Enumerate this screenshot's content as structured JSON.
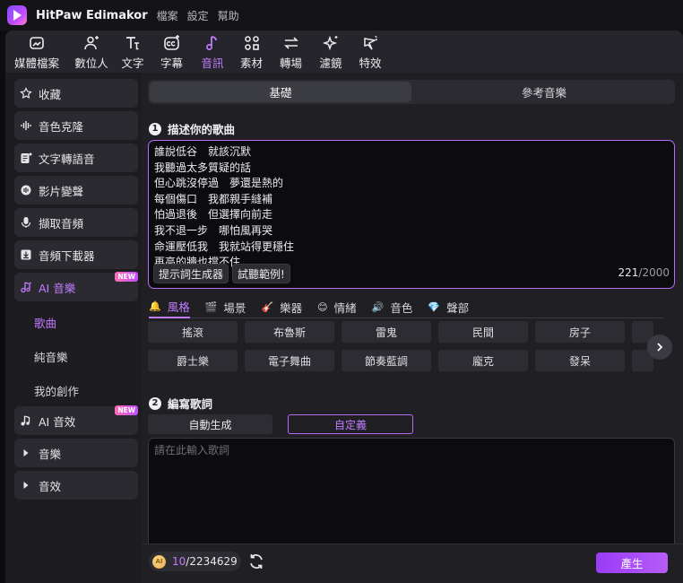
{
  "app": {
    "title": "HitPaw Edimakor",
    "menu": [
      "檔案",
      "設定",
      "幫助"
    ]
  },
  "toolbar": {
    "items": [
      {
        "label": "媒體檔案",
        "icon": "media-icon"
      },
      {
        "label": "數位人",
        "icon": "avatar-icon"
      },
      {
        "label": "文字",
        "icon": "text-icon"
      },
      {
        "label": "字幕",
        "icon": "subtitle-icon"
      },
      {
        "label": "音訊",
        "icon": "music-note-icon",
        "active": true
      },
      {
        "label": "素材",
        "icon": "material-icon"
      },
      {
        "label": "轉場",
        "icon": "transition-icon"
      },
      {
        "label": "濾鏡",
        "icon": "filter-icon"
      },
      {
        "label": "特效",
        "icon": "effect-icon"
      }
    ]
  },
  "sidebar": {
    "items": [
      {
        "label": "收藏",
        "icon": "star-icon"
      },
      {
        "label": "音色克隆",
        "icon": "waveform-icon"
      },
      {
        "label": "文字轉語音",
        "icon": "text-to-speech-icon"
      },
      {
        "label": "影片變聲",
        "icon": "voice-change-icon"
      },
      {
        "label": "擷取音頻",
        "icon": "microphone-icon"
      },
      {
        "label": "音頻下載器",
        "icon": "download-icon"
      },
      {
        "label": "AI 音樂",
        "icon": "ai-music-icon",
        "badge": "NEW",
        "active": true
      },
      {
        "label": "AI 音效",
        "icon": "ai-sound-effect-icon",
        "badge": "NEW"
      },
      {
        "label": "音樂",
        "icon": "caret-right-icon"
      },
      {
        "label": "音效",
        "icon": "caret-right-icon"
      }
    ],
    "sub_items": [
      {
        "label": "歌曲",
        "active": true
      },
      {
        "label": "純音樂"
      },
      {
        "label": "我的創作"
      }
    ]
  },
  "main": {
    "tabs": [
      {
        "label": "基礎",
        "active": true
      },
      {
        "label": "參考音樂"
      }
    ],
    "section1": {
      "number": "1",
      "title": "描述你的歌曲"
    },
    "lyrics": "誰說低谷　就該沉默\n我聽過太多質疑的話\n但心跳沒停過　夢還是熱的\n每個傷口　我都親手縫補\n怕過退後　但選擇向前走\n我不退一步　哪怕風再哭\n命運壓低我　我就站得更穩住\n再高的牆也擋不住",
    "prompt_generator_label": "提示詞生成器",
    "try_example_label": "試聽範例!",
    "char_count_current": "221",
    "char_count_max": "/2000",
    "category_tabs": [
      {
        "label": "風格",
        "icon": "🔔",
        "active": true
      },
      {
        "label": "場景",
        "icon": "🎬"
      },
      {
        "label": "樂器",
        "icon": "🎸"
      },
      {
        "label": "情緒",
        "icon": "😊"
      },
      {
        "label": "音色",
        "icon": "🔊"
      },
      {
        "label": "聲部",
        "icon": "💎"
      }
    ],
    "tags_row1": [
      "搖滾",
      "布魯斯",
      "雷鬼",
      "民間",
      "房子"
    ],
    "tags_row2": [
      "爵士樂",
      "電子舞曲",
      "節奏藍調",
      "龐克",
      "發呆"
    ],
    "section2": {
      "number": "2",
      "title": "編寫歌詞"
    },
    "mode_auto": "自動生成",
    "mode_custom": "自定義",
    "compose_placeholder": "請在此輸入歌詞"
  },
  "footer": {
    "coin_label": "AI",
    "credits_used": "10",
    "credits_total": "/2234629",
    "generate_label": "產生"
  },
  "colors": {
    "accent": "#c27bff",
    "generate": "#9a3cf6"
  }
}
